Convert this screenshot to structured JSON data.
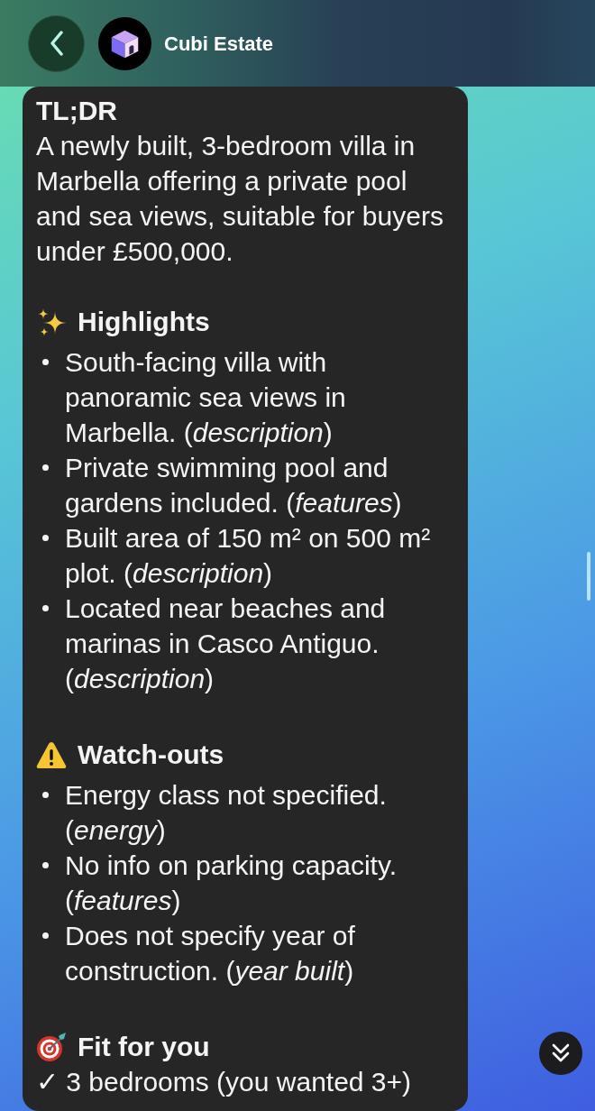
{
  "header": {
    "title": "Cubi Estate"
  },
  "message": {
    "tldr": {
      "heading": "TL;DR",
      "text": "A newly built, 3-bedroom villa in Marbella offering a private pool and sea views, suitable for buyers under £500,000."
    },
    "sections": [
      {
        "kind": "highlights",
        "heading": "Highlights",
        "items": [
          "South-facing villa with panoramic sea views in Marbella. (*description*)",
          "Private swimming pool and gardens included. (*features*)",
          "Built area of 150 m² on 500 m² plot. (*description*)",
          "Located near beaches and marinas in Casco Antiguo. (*description*)"
        ]
      },
      {
        "kind": "watch_outs",
        "heading": "Watch-outs",
        "items": [
          "Energy class not specified. (*energy*)",
          "No info on parking capacity. (*features*)",
          "Does not specify year of construction. (*year built*)"
        ]
      },
      {
        "kind": "fit",
        "heading": "Fit for you",
        "items": [
          "✓ 3 bedrooms (you wanted 3+)"
        ]
      }
    ]
  }
}
